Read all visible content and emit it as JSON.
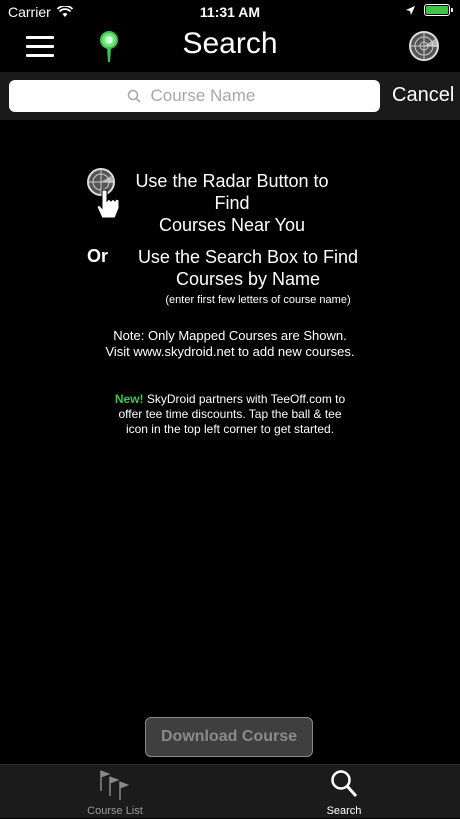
{
  "status_bar": {
    "carrier": "Carrier",
    "time": "11:31 AM"
  },
  "nav": {
    "title": "Search"
  },
  "search": {
    "placeholder": "Course Name",
    "value": "",
    "cancel_label": "Cancel"
  },
  "content": {
    "radar_line1": "Use the Radar Button to Find",
    "radar_line2": "Courses Near You",
    "or_label": "Or",
    "search_line1": "Use the Search Box to Find",
    "search_line2": "Courses by Name",
    "search_hint": "(enter first few letters of course name)",
    "note_line1": "Note: Only Mapped Courses are Shown.",
    "note_line2": "Visit www.skydroid.net to add new courses.",
    "promo_new": "New!",
    "promo_line1": " SkyDroid partners with TeeOff.com to",
    "promo_line2": "offer tee time discounts. Tap the ball & tee",
    "promo_line3": "icon in the top left corner to get started."
  },
  "download_button": {
    "label": "Download Course"
  },
  "tabs": [
    {
      "label": "Course List",
      "icon": "flags-icon",
      "selected": false
    },
    {
      "label": "Search",
      "icon": "magnifier-icon",
      "selected": true
    }
  ],
  "colors": {
    "accent_green": "#3ec44a",
    "background": "#000000",
    "tabbar": "#1b1b1b"
  }
}
